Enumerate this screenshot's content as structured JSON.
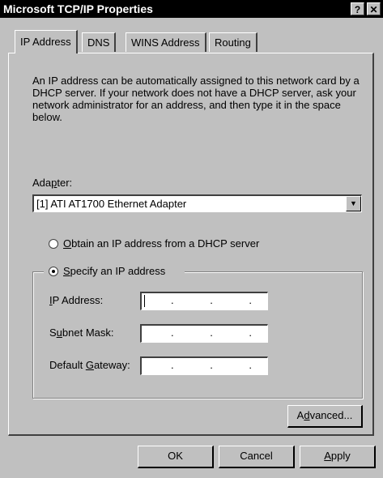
{
  "window": {
    "title": "Microsoft TCP/IP Properties",
    "help_glyph": "?",
    "close_glyph": "✕"
  },
  "tabs": [
    {
      "label": "IP Address",
      "active": true
    },
    {
      "label": "DNS",
      "active": false
    },
    {
      "label": "WINS Address",
      "active": false
    },
    {
      "label": "Routing",
      "active": false
    }
  ],
  "description": "An IP address can be automatically assigned to this network card by a DHCP server.  If your network does not have a DHCP server, ask your network administrator for an address, and then type it in the space below.",
  "adapter": {
    "label_pre": "Ada",
    "label_key": "p",
    "label_post": "ter:",
    "value": "[1] ATI AT1700 Ethernet Adapter",
    "arrow_glyph": "▼"
  },
  "radios": {
    "dhcp": {
      "key": "O",
      "rest": "btain an IP address from a DHCP server",
      "selected": false
    },
    "specify": {
      "key": "S",
      "rest": "pecify an IP address",
      "selected": true
    }
  },
  "fields": {
    "ip_address": {
      "pre": "",
      "key": "I",
      "post": "P Address:",
      "value": ". . ."
    },
    "subnet_mask": {
      "pre": "S",
      "key": "u",
      "post": "bnet Mask:",
      "value": ". . ."
    },
    "default_gateway": {
      "pre": "Default ",
      "key": "G",
      "post": "ateway:",
      "value": ". . ."
    }
  },
  "buttons": {
    "advanced": {
      "pre": "A",
      "key": "d",
      "post": "vanced..."
    },
    "ok": "OK",
    "cancel": "Cancel",
    "apply": {
      "pre": "",
      "key": "A",
      "post": "pply"
    }
  }
}
